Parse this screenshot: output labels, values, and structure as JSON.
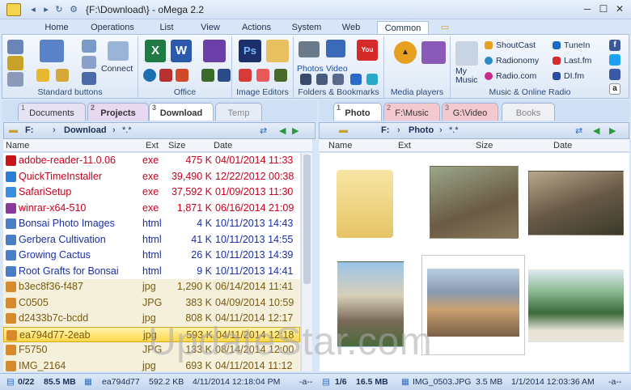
{
  "window": {
    "title": "{F:\\Download\\} - oMega 2.2"
  },
  "menu": [
    "Home",
    "Operations",
    "List",
    "View",
    "Actions",
    "System",
    "Web",
    "Common"
  ],
  "ribbon": {
    "standard_label": "Standard buttons",
    "connect_label": "Connect",
    "office_label": "Office",
    "image_editors_label": "Image Editors",
    "folders_label": "Folders & Bookmarks",
    "photos_label": "Photos",
    "video_label": "Video",
    "media_label": "Media players",
    "music_label": "Music & Online Radio",
    "my_music_label": "My Music",
    "radio_links": [
      "ShoutCast",
      "Radionomy",
      "Radio.com"
    ],
    "radio_links2": [
      "TuneIn",
      "Last.fm",
      "DI.fm"
    ]
  },
  "left_tabs": [
    {
      "num": "1",
      "label": "Documents"
    },
    {
      "num": "2",
      "label": "Projects"
    },
    {
      "num": "3",
      "label": "Download"
    },
    {
      "num": "",
      "label": "Temp"
    }
  ],
  "right_tabs": [
    {
      "num": "1",
      "label": "Photo"
    },
    {
      "num": "2",
      "label": "F:\\Music"
    },
    {
      "num": "3",
      "label": "G:\\Video"
    },
    {
      "num": "",
      "label": "Books"
    }
  ],
  "left_path": [
    "F:",
    "Download",
    "*.*"
  ],
  "right_path": [
    "F:",
    "Photo",
    "*.*"
  ],
  "columns": {
    "name": "Name",
    "ext": "Ext",
    "size": "Size",
    "date": "Date"
  },
  "files": [
    {
      "name": "adobe-reader-11.0.06",
      "ext": "exe",
      "size": "475 K",
      "date": "04/01/2014 11:33",
      "color": "#c8001e",
      "icon": "#c81414"
    },
    {
      "name": "QuickTimeInstaller",
      "ext": "exe",
      "size": "39,490 K",
      "date": "12/22/2012 00:38",
      "color": "#c8001e",
      "icon": "#2a7fd4"
    },
    {
      "name": "SafariSetup",
      "ext": "exe",
      "size": "37,592 K",
      "date": "01/09/2013 11:30",
      "color": "#c8001e",
      "icon": "#3a8fe0"
    },
    {
      "name": "winrar-x64-510",
      "ext": "exe",
      "size": "1,871 K",
      "date": "06/16/2014 21:09",
      "color": "#c8001e",
      "icon": "#8a3a9a"
    },
    {
      "name": "Bonsai Photo Images",
      "ext": "html",
      "size": "4 K",
      "date": "10/11/2013 14:43",
      "color": "#1a2fa8",
      "icon": "#4a7fc8"
    },
    {
      "name": "Gerbera Cultivation",
      "ext": "html",
      "size": "41 K",
      "date": "10/11/2013 14:55",
      "color": "#1a2fa8",
      "icon": "#4a7fc8"
    },
    {
      "name": "Growing Cactus",
      "ext": "html",
      "size": "26 K",
      "date": "10/11/2013 14:39",
      "color": "#1a2fa8",
      "icon": "#4a7fc8"
    },
    {
      "name": "Root Grafts for Bonsai",
      "ext": "html",
      "size": "9 K",
      "date": "10/11/2013 14:41",
      "color": "#1a2fa8",
      "icon": "#4a7fc8"
    },
    {
      "name": "b3ec8f36-f487",
      "ext": "jpg",
      "size": "1,290 K",
      "date": "06/14/2014 11:41",
      "color": "#7a5a10",
      "icon": "#d88a2a"
    },
    {
      "name": "C0505",
      "ext": "JPG",
      "size": "383 K",
      "date": "04/09/2014 10:59",
      "color": "#7a5a10",
      "icon": "#d88a2a"
    },
    {
      "name": "d2433b7c-bcdd",
      "ext": "jpg",
      "size": "808 K",
      "date": "04/11/2014 12:17",
      "color": "#7a5a10",
      "icon": "#d88a2a"
    },
    {
      "name": "ea794d77-2eab",
      "ext": "jpg",
      "size": "593 K",
      "date": "04/11/2014 12:18",
      "color": "#7a5a10",
      "icon": "#d88a2a"
    },
    {
      "name": "F5750",
      "ext": "JPG",
      "size": "133 K",
      "date": "08/14/2014 12:00",
      "color": "#7a5a10",
      "icon": "#d88a2a"
    },
    {
      "name": "IMG_2164",
      "ext": "jpg",
      "size": "693 K",
      "date": "04/11/2014 11:12",
      "color": "#7a5a10",
      "icon": "#d88a2a"
    }
  ],
  "selected_index": 11,
  "status": {
    "left_count": "0/22",
    "left_size": "85.5 MB",
    "left_file": "ea794d77",
    "left_fsize": "592.2 KB",
    "left_date": "4/11/2014 12:18:04 PM",
    "left_attr": "-a--",
    "right_count": "1/6",
    "right_size": "16.5 MB",
    "right_file": "IMG_0503.JPG",
    "right_fsize": "3.5 MB",
    "right_date": "1/1/2014 12:03:36 AM",
    "right_attr": "-a--"
  },
  "watermark": "UpdateStar.com"
}
